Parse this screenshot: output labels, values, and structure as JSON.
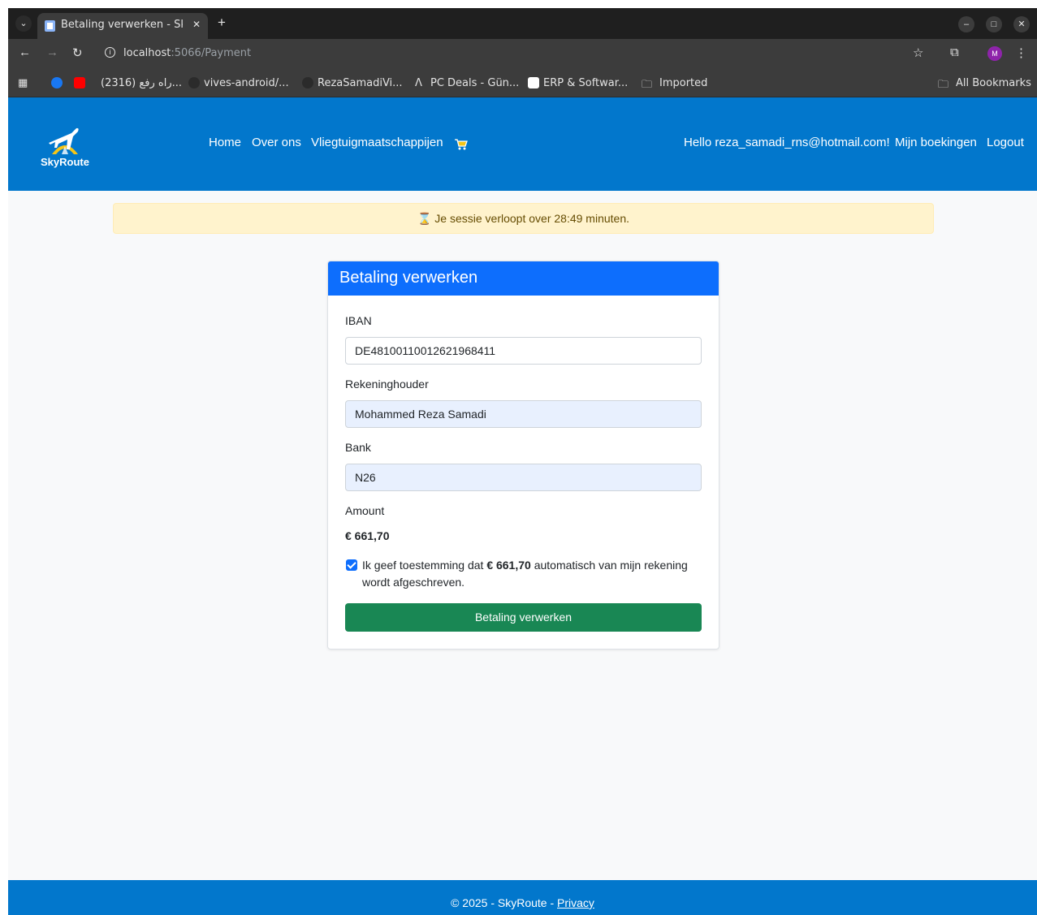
{
  "browser": {
    "tab_title": "Betaling verwerken - SkyRoute",
    "url_host": "localhost",
    "url_path": ":5066/Payment",
    "profile_initial": "M",
    "bookmarks": [
      "(2316) راه رفع...",
      "vives-android/...",
      "RezaSamadiVi...",
      "PC Deals - Gün...",
      "ERP & Softwar...",
      "Imported"
    ],
    "all_bookmarks": "All Bookmarks"
  },
  "header": {
    "logo_text": "SkyRoute",
    "nav": [
      "Home",
      "Over ons",
      "Vliegtuigmaatschappijen"
    ],
    "greeting": "Hello reza_samadi_rns@hotmail.com!",
    "my_bookings": "Mijn boekingen",
    "logout": "Logout"
  },
  "session_alert": "⌛ Je sessie verloopt over 28:49 minuten.",
  "payment": {
    "title": "Betaling verwerken",
    "iban_label": "IBAN",
    "iban_value": "DE48100110012621968411",
    "holder_label": "Rekeninghouder",
    "holder_value": "Mohammed Reza Samadi",
    "bank_label": "Bank",
    "bank_value": "N26",
    "amount_label": "Amount",
    "amount_value": "€ 661,70",
    "consent_prefix": "Ik geef toestemming dat ",
    "consent_amount": "€ 661,70",
    "consent_suffix": " automatisch van mijn rekening wordt afgeschreven.",
    "consent_checked": true,
    "submit_label": "Betaling verwerken"
  },
  "footer": {
    "text": "© 2025 - SkyRoute - ",
    "privacy": "Privacy"
  },
  "colors": {
    "header_bg": "#0277cc",
    "card_header": "#0d6efd",
    "submit": "#198754",
    "alert_bg": "#fff3cd"
  }
}
